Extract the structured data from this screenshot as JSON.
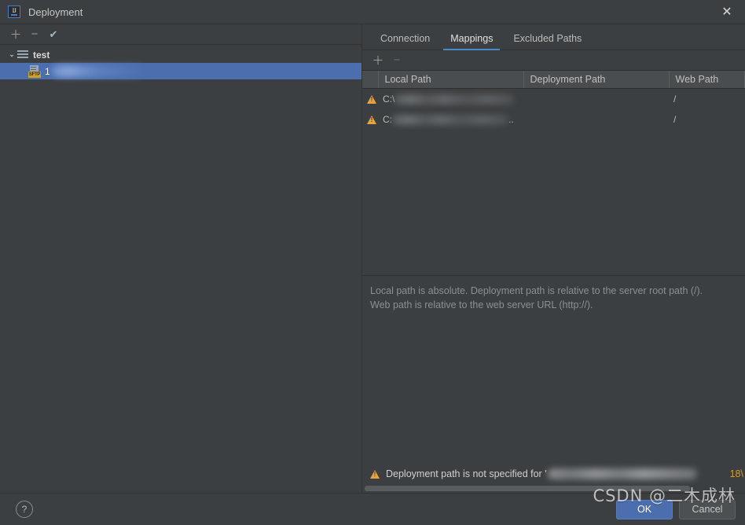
{
  "window": {
    "title": "Deployment",
    "app_icon": "intellij-idea-icon",
    "icon_text": "IJ",
    "close_label": "✕"
  },
  "left_panel": {
    "toolbar": [
      {
        "name": "add-server-button",
        "glyph": "＋"
      },
      {
        "name": "remove-server-button",
        "glyph": "−"
      },
      {
        "name": "set-default-server-button",
        "glyph": "✔"
      }
    ],
    "tree": [
      {
        "name": "tree-group-test",
        "label": "test",
        "chevron": "⌄",
        "icon": "server-group-icon",
        "expanded": true,
        "selected": false
      },
      {
        "name": "tree-item-sftp-server",
        "label": "1",
        "icon": "sftp-server-icon",
        "icon_tag": "SFTP",
        "selected": true,
        "redacted": true
      }
    ]
  },
  "right_panel": {
    "tabs": [
      {
        "label": "Connection",
        "active": false
      },
      {
        "label": "Mappings",
        "active": true
      },
      {
        "label": "Excluded Paths",
        "active": false
      }
    ],
    "toolbar": [
      {
        "name": "add-mapping-button",
        "glyph": "＋",
        "enabled": true
      },
      {
        "name": "remove-mapping-button",
        "glyph": "−",
        "enabled": false
      }
    ],
    "table": {
      "columns": [
        "",
        "Local Path",
        "Deployment Path",
        "Web Path"
      ],
      "rows": [
        {
          "warning": true,
          "local_path": "C:\\",
          "local_path_redacted": true,
          "deployment_path": "",
          "web_path": "/"
        },
        {
          "warning": true,
          "local_path": "C:",
          "local_path_redacted": true,
          "local_path_suffix": "..",
          "deployment_path": "",
          "web_path": "/"
        }
      ]
    },
    "hint_line_1": "Local path is absolute. Deployment path is relative to the server root path (/).",
    "hint_line_2": "Web path is relative to the web server URL (http://).",
    "bottom_warning": {
      "icon": "warning-icon",
      "text": "Deployment path is not specified for '",
      "redacted": true,
      "tail": "18\\"
    }
  },
  "footer": {
    "help_label": "?",
    "ok_label": "OK",
    "cancel_label": "Cancel"
  },
  "watermark": "CSDN @二木成林",
  "colors": {
    "background": "#3c3f41",
    "selection_blue": "#4b6eaf",
    "accent_blue": "#4a88c7",
    "warning_orange": "#e8a33d",
    "header_grey": "#4a4d4f"
  }
}
